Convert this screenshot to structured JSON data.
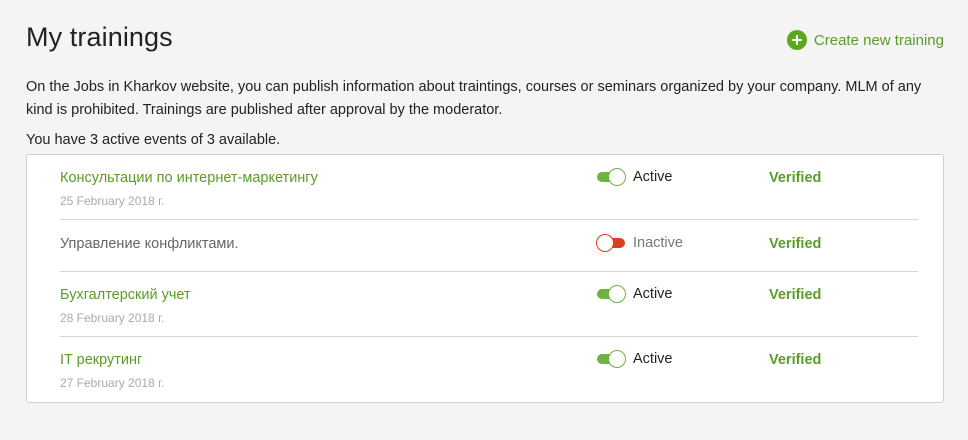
{
  "header": {
    "title": "My trainings",
    "create_label": "Create new training"
  },
  "description": "On the Jobs in Kharkov website, you can publish information about traintings, courses or seminars organized by your company. MLM of any kind is prohibited. Trainings are published after approval by the moderator.",
  "summary": "You have 3 active events of 3 available.",
  "trainings": [
    {
      "title": "Консультации по интернет-маркетингу",
      "date": "25 February 2018 г.",
      "active": true,
      "status": "Active",
      "verification": "Verified"
    },
    {
      "title": "Управление конфликтами.",
      "date": "",
      "active": false,
      "status": "Inactive",
      "verification": "Verified"
    },
    {
      "title": "Бухгалтерский учет",
      "date": "28 February 2018 г.",
      "active": true,
      "status": "Active",
      "verification": "Verified"
    },
    {
      "title": "IT рекрутинг",
      "date": "27 February 2018 г.",
      "active": true,
      "status": "Active",
      "verification": "Verified"
    }
  ],
  "colors": {
    "accent": "#5b9c2a",
    "toggle_on": "#6db33f",
    "toggle_off": "#d9401e"
  }
}
